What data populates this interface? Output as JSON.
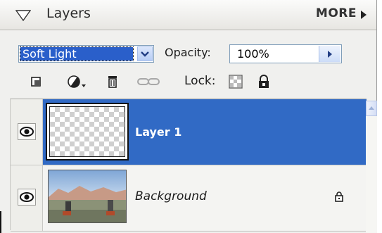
{
  "header": {
    "title": "Layers",
    "more_label": "MORE"
  },
  "options": {
    "blend_mode": "Soft Light",
    "opacity_label": "Opacity:",
    "opacity_value": "100%"
  },
  "toolbar": {
    "lock_label": "Lock:"
  },
  "layers": [
    {
      "name": "Layer 1",
      "selected": true,
      "visible": true
    },
    {
      "name": "Background",
      "selected": false,
      "visible": true,
      "locked": true
    }
  ],
  "colors": {
    "selection": "#316ac5",
    "panel_bg": "#f0f0ee"
  }
}
